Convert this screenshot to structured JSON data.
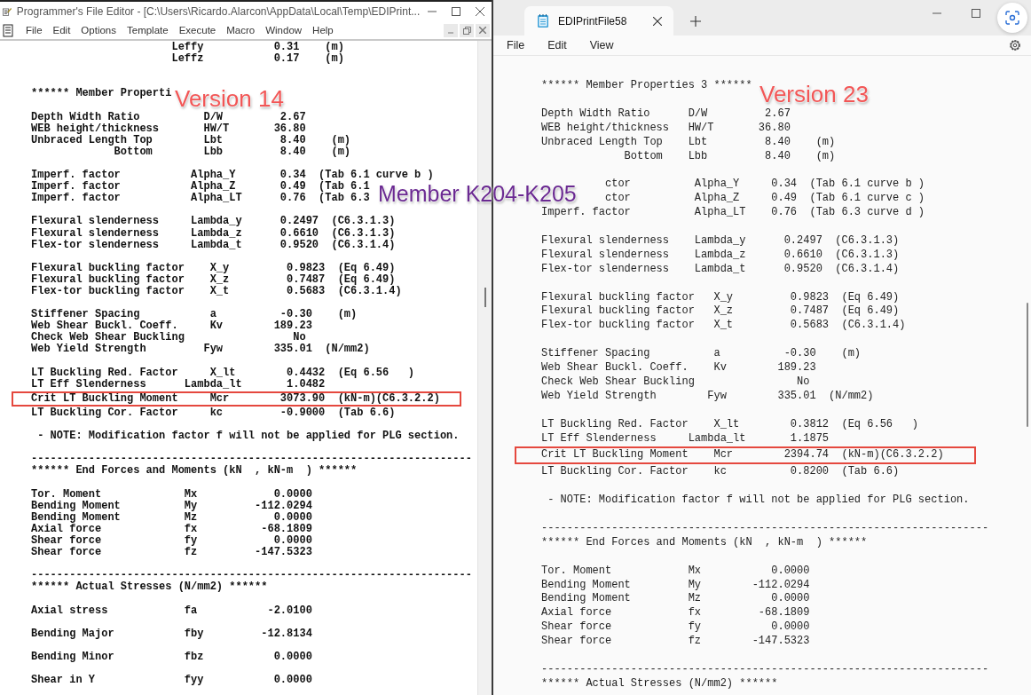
{
  "left_window": {
    "title": "Programmer's File Editor - [C:\\Users\\Ricardo.Alarcon\\AppData\\Local\\Temp\\EDIPrint...",
    "menu": [
      "File",
      "Edit",
      "Options",
      "Template",
      "Execute",
      "Macro",
      "Window",
      "Help"
    ],
    "blocks": [
      {
        "lines": [
          {
            "text": "                      Leffy           0.31    (m)",
            "highlighted": false
          },
          {
            "text": "                      Leffz           0.17    (m)",
            "highlighted": false
          }
        ]
      },
      {
        "lines": [
          {
            "text": "****** Member Properti",
            "highlighted": false
          }
        ]
      },
      {
        "lines": [
          {
            "text": "Depth Width Ratio          D/W         2.67",
            "highlighted": false
          },
          {
            "text": "WEB height/thickness       HW/T       36.80",
            "highlighted": false
          },
          {
            "text": "Unbraced Length Top        Lbt         8.40    (m)",
            "highlighted": false
          },
          {
            "text": "             Bottom        Lbb         8.40    (m)",
            "highlighted": false
          }
        ]
      },
      {
        "lines": [
          {
            "text": "Imperf. factor           Alpha_Y       0.34  (Tab 6.1 curve b )",
            "highlighted": false
          },
          {
            "text": "Imperf. factor           Alpha_Z       0.49  (Tab 6.1",
            "highlighted": false
          },
          {
            "text": "Imperf. factor           Alpha_LT      0.76  (Tab 6.3",
            "highlighted": false
          }
        ]
      },
      {
        "lines": [
          {
            "text": "Flexural slenderness     Lambda_y      0.2497  (C6.3.1.3)",
            "highlighted": false
          },
          {
            "text": "Flexural slenderness     Lambda_z      0.6610  (C6.3.1.3)",
            "highlighted": false
          },
          {
            "text": "Flex-tor slenderness     Lambda_t      0.9520  (C6.3.1.4)",
            "highlighted": false
          }
        ]
      },
      {
        "lines": [
          {
            "text": "Flexural buckling factor    X_y         0.9823  (Eq 6.49)",
            "highlighted": false
          },
          {
            "text": "Flexural buckling factor    X_z         0.7487  (Eq 6.49)",
            "highlighted": false
          },
          {
            "text": "Flex-tor buckling factor    X_t         0.5683  (C6.3.1.4)",
            "highlighted": false
          }
        ]
      },
      {
        "lines": [
          {
            "text": "Stiffener Spacing           a          -0.30    (m)",
            "highlighted": false
          },
          {
            "text": "Web Shear Buckl. Coeff.     Kv        189.23",
            "highlighted": false
          },
          {
            "text": "Check Web Shear Buckling                 No",
            "highlighted": false
          },
          {
            "text": "Web Yield Strength         Fyw        335.01  (N/mm2)",
            "highlighted": false
          }
        ]
      },
      {
        "lines": [
          {
            "text": "LT Buckling Red. Factor     X_lt        0.4432  (Eq 6.56   )",
            "highlighted": false
          },
          {
            "text": "LT Eff Slenderness      Lambda_lt       1.0482",
            "highlighted": false
          },
          {
            "text": "Crit LT Buckling Moment     Mcr        3073.90  (kN-m)(C6.3.2.2)",
            "highlighted": true
          },
          {
            "text": "LT Buckling Cor. Factor     kc         -0.9000  (Tab 6.6)",
            "highlighted": false
          }
        ]
      },
      {
        "lines": [
          {
            "text": " - NOTE: Modification factor f will not be applied for PLG section.",
            "highlighted": false
          }
        ]
      },
      {
        "lines": [
          {
            "text": "---------------------------------------------------------------------",
            "highlighted": false
          },
          {
            "text": "****** End Forces and Moments (kN  , kN-m  ) ******",
            "highlighted": false
          }
        ]
      },
      {
        "lines": [
          {
            "text": "Tor. Moment             Mx            0.0000",
            "highlighted": false
          },
          {
            "text": "Bending Moment          My         -112.0294",
            "highlighted": false
          },
          {
            "text": "Bending Moment          Mz            0.0000",
            "highlighted": false
          },
          {
            "text": "Axial force             fx          -68.1809",
            "highlighted": false
          },
          {
            "text": "Shear force             fy            0.0000",
            "highlighted": false
          },
          {
            "text": "Shear force             fz         -147.5323",
            "highlighted": false
          }
        ]
      },
      {
        "lines": [
          {
            "text": "---------------------------------------------------------------------",
            "highlighted": false
          },
          {
            "text": "****** Actual Stresses (N/mm2) ******",
            "highlighted": false
          }
        ]
      },
      {
        "lines": [
          {
            "text": "Axial stress            fa           -2.0100",
            "highlighted": false
          }
        ]
      },
      {
        "lines": [
          {
            "text": "Bending Major           fby         -12.8134",
            "highlighted": false
          }
        ]
      },
      {
        "lines": [
          {
            "text": "Bending Minor           fbz           0.0000",
            "highlighted": false
          }
        ]
      },
      {
        "lines": [
          {
            "text": "Shear in Y              fyy           0.0000",
            "highlighted": false
          }
        ]
      }
    ]
  },
  "right_window": {
    "tab": "EDIPrintFile58",
    "menu": [
      "File",
      "Edit",
      "View"
    ],
    "blocks": [
      {
        "lines": [
          {
            "text": "****** Member Properties 3 ******",
            "highlighted": false
          }
        ]
      },
      {
        "lines": [
          {
            "text": "Depth Width Ratio      D/W         2.67",
            "highlighted": false
          },
          {
            "text": "WEB height/thickness   HW/T       36.80",
            "highlighted": false
          },
          {
            "text": "Unbraced Length Top    Lbt         8.40    (m)",
            "highlighted": false
          },
          {
            "text": "             Bottom    Lbb         8.40    (m)",
            "highlighted": false
          }
        ]
      },
      {
        "lines": [
          {
            "text": "          ctor          Alpha_Y     0.34  (Tab 6.1 curve b )",
            "highlighted": false
          },
          {
            "text": "          ctor          Alpha_Z     0.49  (Tab 6.1 curve c )",
            "highlighted": false
          },
          {
            "text": "Imperf. factor          Alpha_LT    0.76  (Tab 6.3 curve d )",
            "highlighted": false
          }
        ]
      },
      {
        "lines": [
          {
            "text": "Flexural slenderness    Lambda_y      0.2497  (C6.3.1.3)",
            "highlighted": false
          },
          {
            "text": "Flexural slenderness    Lambda_z      0.6610  (C6.3.1.3)",
            "highlighted": false
          },
          {
            "text": "Flex-tor slenderness    Lambda_t      0.9520  (C6.3.1.4)",
            "highlighted": false
          }
        ]
      },
      {
        "lines": [
          {
            "text": "Flexural buckling factor   X_y         0.9823  (Eq 6.49)",
            "highlighted": false
          },
          {
            "text": "Flexural buckling factor   X_z         0.7487  (Eq 6.49)",
            "highlighted": false
          },
          {
            "text": "Flex-tor buckling factor   X_t         0.5683  (C6.3.1.4)",
            "highlighted": false
          }
        ]
      },
      {
        "lines": [
          {
            "text": "Stiffener Spacing          a          -0.30    (m)",
            "highlighted": false
          },
          {
            "text": "Web Shear Buckl. Coeff.    Kv        189.23",
            "highlighted": false
          },
          {
            "text": "Check Web Shear Buckling                No",
            "highlighted": false
          },
          {
            "text": "Web Yield Strength        Fyw        335.01  (N/mm2)",
            "highlighted": false
          }
        ]
      },
      {
        "lines": [
          {
            "text": "LT Buckling Red. Factor    X_lt        0.3812  (Eq 6.56   )",
            "highlighted": false
          },
          {
            "text": "LT Eff Slenderness     Lambda_lt       1.1875",
            "highlighted": false
          },
          {
            "text": "Crit LT Buckling Moment    Mcr        2394.74  (kN-m)(C6.3.2.2)",
            "highlighted": true
          },
          {
            "text": "LT Buckling Cor. Factor    kc          0.8200  (Tab 6.6)",
            "highlighted": false
          }
        ]
      },
      {
        "lines": [
          {
            "text": " - NOTE: Modification factor f will not be applied for PLG section.",
            "highlighted": false
          }
        ]
      },
      {
        "lines": [
          {
            "text": "----------------------------------------------------------------------",
            "highlighted": false
          },
          {
            "text": "****** End Forces and Moments (kN  , kN-m  ) ******",
            "highlighted": false
          }
        ]
      },
      {
        "lines": [
          {
            "text": "Tor. Moment            Mx           0.0000",
            "highlighted": false
          },
          {
            "text": "Bending Moment         My        -112.0294",
            "highlighted": false
          },
          {
            "text": "Bending Moment         Mz           0.0000",
            "highlighted": false
          },
          {
            "text": "Axial force            fx         -68.1809",
            "highlighted": false
          },
          {
            "text": "Shear force            fy           0.0000",
            "highlighted": false
          },
          {
            "text": "Shear force            fz        -147.5323",
            "highlighted": false
          }
        ]
      },
      {
        "lines": [
          {
            "text": "----------------------------------------------------------------------",
            "highlighted": false
          },
          {
            "text": "****** Actual Stresses (N/mm2) ******",
            "highlighted": false
          }
        ]
      }
    ]
  },
  "annotations": [
    {
      "text": "Version 14",
      "kind": "version"
    },
    {
      "text": "Version 23",
      "kind": "version"
    },
    {
      "text": "Member K204-K205",
      "kind": "member"
    }
  ]
}
